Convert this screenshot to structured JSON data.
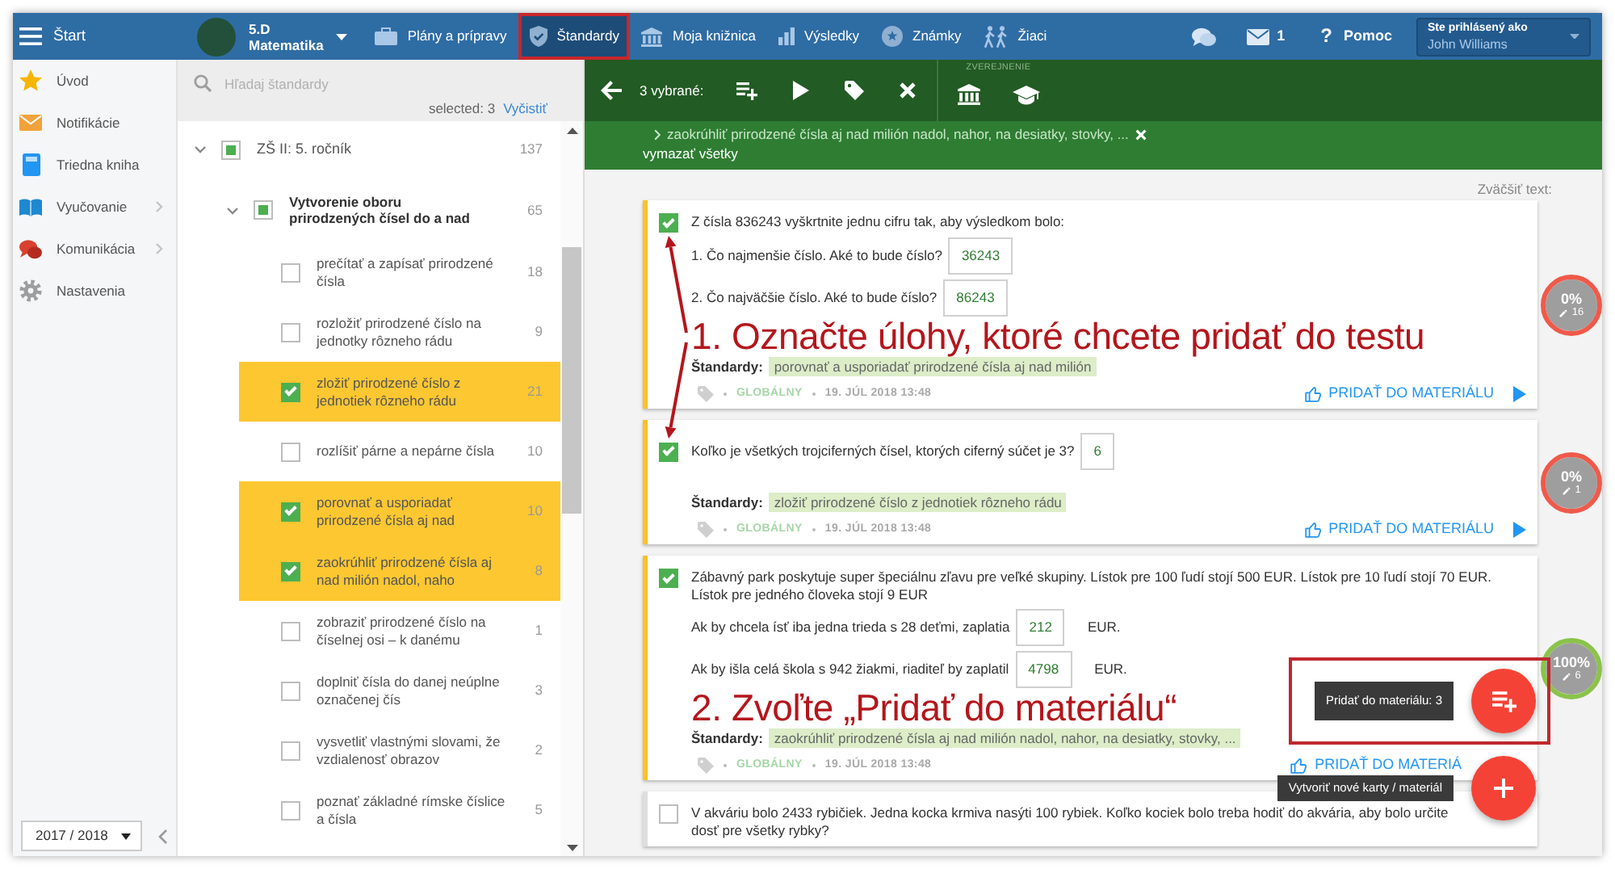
{
  "navbar": {
    "start": "Štart",
    "class_name": "5.D",
    "subject": "Matematika",
    "items": [
      {
        "label": "Plány a prípravy",
        "selected": false,
        "highlighted": false
      },
      {
        "label": "Štandardy",
        "selected": true,
        "highlighted": true
      },
      {
        "label": "Moja knižnica",
        "selected": false,
        "highlighted": false
      },
      {
        "label": "Výsledky",
        "selected": false,
        "highlighted": false
      },
      {
        "label": "Známky",
        "selected": false,
        "highlighted": false
      },
      {
        "label": "Žiaci",
        "selected": false,
        "highlighted": false
      }
    ],
    "messages": "1",
    "help_icon": "?",
    "help": "Pomoc",
    "user": {
      "caption": "Ste prihlásený ako",
      "name": "John Williams"
    }
  },
  "sidebar": {
    "items": [
      {
        "label": "Úvod",
        "submenu": false
      },
      {
        "label": "Notifikácie",
        "submenu": false
      },
      {
        "label": "Triedna kniha",
        "submenu": false
      },
      {
        "label": "Vyučovanie",
        "submenu": true
      },
      {
        "label": "Komunikácia",
        "submenu": true
      },
      {
        "label": "Nastavenia",
        "submenu": false
      }
    ],
    "school_year": "2017 / 2018"
  },
  "standards": {
    "search": {
      "placeholder": "Hľadaj štandardy"
    },
    "selected_count": "selected: 3",
    "clear": "Vyčistiť",
    "tree": [
      {
        "label": "ZŠ II: 5. ročník",
        "count": "137",
        "partial": true,
        "expanded": true,
        "children": [
          {
            "label": "Vytvorenie oboru prirodzených čísel do a nad",
            "count": "65",
            "partial": true,
            "expanded": true,
            "children": [
              {
                "label": "prečítať a zapísať prirodzené čísla",
                "count": "18",
                "checked": false
              },
              {
                "label": "rozložiť prirodzené číslo na jednotky rôzneho rádu",
                "count": "9",
                "checked": false
              },
              {
                "label": "zložiť prirodzené číslo z jednotiek rôzneho rádu",
                "count": "21",
                "checked": true
              },
              {
                "label": "rozlíšiť párne a nepárne čísla",
                "count": "10",
                "checked": false
              },
              {
                "label": "porovnať a usporiadať prirodzené čísla aj nad",
                "count": "10",
                "checked": true
              },
              {
                "label": "zaokrúhliť prirodzené čísla aj nad milión nadol, naho",
                "count": "8",
                "checked": true
              },
              {
                "label": "zobraziť prirodzené číslo na číselnej osi – k danému",
                "count": "1",
                "checked": false
              },
              {
                "label": "doplniť čísla do danej neúplne označenej čís",
                "count": "3",
                "checked": false
              },
              {
                "label": "vysvetliť vlastnými slovami, že vzdialenosť obrazov",
                "count": "2",
                "checked": false
              },
              {
                "label": "poznať základné rímske číslice a čísla",
                "count": "5",
                "checked": false
              }
            ]
          }
        ]
      }
    ]
  },
  "toolbar": {
    "selection": "3 vybrané:",
    "publish_caption": "ZVEREJNENIE"
  },
  "filters": {
    "items": [
      {
        "label": "zaokrúhliť prirodzené čísla aj nad milión nadol, nahor, na desiatky, stovky, ..."
      }
    ],
    "clear_all": "vymazať všetky"
  },
  "zoom_label": "Zväčšiť text:",
  "tasks": [
    {
      "checked": true,
      "prompt": "Z čísla 836243 vyškrtnite jednu cifru tak, aby výsledkom bolo:",
      "questions": [
        {
          "text": "1. Čo najmenšie číslo. Aké to bude číslo?",
          "answer": "36243"
        },
        {
          "text": "2. Čo najväčšie číslo. Aké to bude číslo?",
          "answer": "86243"
        }
      ],
      "note": {
        "text": "1. Označte úlohy, ktoré chcete pridať do testu",
        "arrows": true
      },
      "standards_label": "Štandardy:",
      "standard": "porovnať a usporiadať prirodzené čísla aj nad milión",
      "scope": "GLOBÁLNY",
      "date": "19. JÚL 2018 13:48",
      "add_label": "PRIDAŤ DO MATERIÁLU",
      "play": true,
      "progress": {
        "percent": "0%",
        "edits": "16",
        "color": "#ef5a4a"
      }
    },
    {
      "checked": true,
      "questions": [
        {
          "text": "Koľko je všetkých trojciferných čísel, ktorých ciferný súčet je 3?",
          "answer": "6"
        }
      ],
      "standards_label": "Štandardy:",
      "standard": "zložiť prirodzené číslo z jednotiek rôzneho rádu",
      "scope": "GLOBÁLNY",
      "date": "19. JÚL 2018 13:48",
      "add_label": "PRIDAŤ DO MATERIÁLU",
      "play": true,
      "progress": {
        "percent": "0%",
        "edits": "1",
        "color": "#ef5a4a"
      }
    },
    {
      "checked": true,
      "prompt": "Zábavný park poskytuje super špeciálnu zľavu pre veľké skupiny. Lístok pre 100 ľudí stojí 500 EUR. Lístok pre 10 ľudí stojí 70 EUR. Lístok pre jedného človeka stojí 9 EUR",
      "questions": [
        {
          "text": "Ak by chcela ísť iba jedna trieda s 28 deťmi, zaplatia",
          "answer": "212",
          "suffix": "EUR."
        },
        {
          "text": "Ak by išla celá škola s 942 žiakmi, riaditeľ by zaplatil",
          "answer": "4798",
          "suffix": "EUR."
        }
      ],
      "note": {
        "text": "2. Zvoľte „Pridať do materiálu“",
        "arrows": false
      },
      "standards_label": "Štandardy:",
      "standard": "zaokrúhliť prirodzené čísla aj nad milión nadol, nahor, na desiatky, stovky, ...",
      "scope": "GLOBÁLNY",
      "date": "19. JÚL 2018 13:48",
      "add_label": "PRIDAŤ DO MATERIÁ",
      "play": false,
      "progress": {
        "percent": "100%",
        "edits": "6",
        "color": "#8bc34a"
      }
    },
    {
      "checked": false,
      "prompt": "V akváriu bolo 2433 rybičiek. Jedna kocka krmiva nasýti 100 rybiek. Koľko kociek bolo treba hodiť do akvária, aby bolo určite dosť pre všetky rybky?"
    }
  ],
  "fabs": [
    {
      "kind": "add",
      "tooltip": "Pridať do materiálu: 3",
      "highlighted": true
    },
    {
      "kind": "create",
      "tooltip": "Vytvoriť nové karty / materiál",
      "highlighted": false
    }
  ]
}
